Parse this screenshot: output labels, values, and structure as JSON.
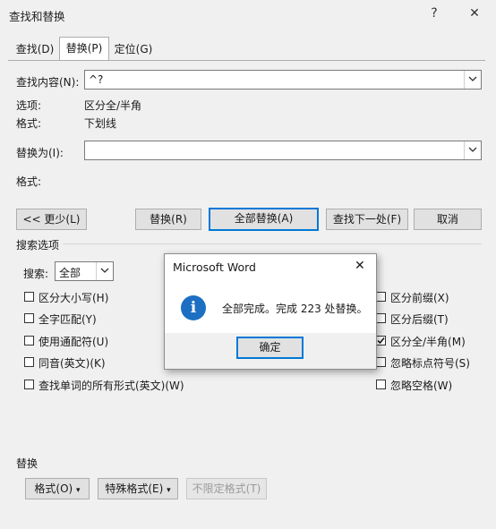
{
  "window": {
    "title": "查找和替换",
    "help_glyph": "?",
    "close_glyph": "✕"
  },
  "tabs": [
    {
      "label": "查找(D)"
    },
    {
      "label": "替换(P)",
      "active": true
    },
    {
      "label": "定位(G)"
    }
  ],
  "find": {
    "label": "查找内容(N):",
    "value": "^?",
    "options_label": "选项:",
    "options_value": "区分全/半角",
    "format_label": "格式:",
    "format_value": "下划线"
  },
  "replace": {
    "label": "替换为(I):",
    "value": "",
    "format_label": "格式:"
  },
  "buttons": {
    "less": "<< 更少(L)",
    "replace": "替换(R)",
    "replace_all": "全部替换(A)",
    "find_next": "查找下一处(F)",
    "cancel": "取消"
  },
  "search_options": {
    "heading": "搜索选项",
    "search_label": "搜索:",
    "search_value": "全部",
    "left": [
      {
        "label": "区分大小写(H)",
        "checked": false
      },
      {
        "label": "全字匹配(Y)",
        "checked": false
      },
      {
        "label": "使用通配符(U)",
        "checked": false
      },
      {
        "label": "同音(英文)(K)",
        "checked": false
      },
      {
        "label": "查找单词的所有形式(英文)(W)",
        "checked": false
      }
    ],
    "right": [
      {
        "label": "区分前缀(X)",
        "checked": false
      },
      {
        "label": "区分后缀(T)",
        "checked": false
      },
      {
        "label": "区分全/半角(M)",
        "checked": true
      },
      {
        "label": "忽略标点符号(S)",
        "checked": false
      },
      {
        "label": "忽略空格(W)",
        "checked": false
      }
    ]
  },
  "replace_section": {
    "heading": "替换",
    "format_btn": "格式(O)",
    "special_btn": "特殊格式(E)",
    "no_format_btn": "不限定格式(T)"
  },
  "message_box": {
    "title": "Microsoft Word",
    "close_glyph": "✕",
    "icon": "info-icon",
    "message": "全部完成。完成 223 处替换。",
    "ok": "确定"
  },
  "colors": {
    "accent": "#0078d7",
    "info_icon": "#1c6fc2"
  }
}
